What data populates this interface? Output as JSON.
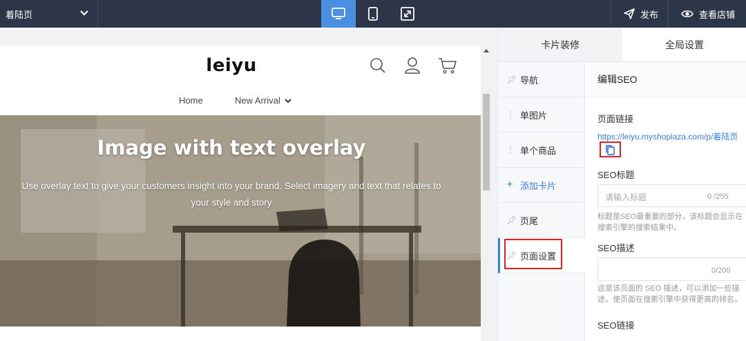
{
  "topbar": {
    "page_select": "着陆页",
    "publish_label": "发布",
    "view_store_label": "查看店铺"
  },
  "preview": {
    "store_logo": "leiyu",
    "nav": [
      "Home",
      "New Arrival"
    ],
    "hero_title": "Image with text overlay",
    "hero_text": "Use overlay text to give your customers insight into your brand. Select imagery and text that relates to your style and story"
  },
  "panel": {
    "tabs": [
      "卡片装修",
      "全局设置"
    ],
    "sidebar": [
      {
        "label": "导航",
        "icon": "pin-icon"
      },
      {
        "label": "单图片",
        "icon": "drag-handle-icon"
      },
      {
        "label": "单个商品",
        "icon": "drag-handle-icon"
      },
      {
        "label": "添加卡片",
        "icon": "plus-icon"
      },
      {
        "label": "页尾",
        "icon": "pin-icon"
      },
      {
        "label": "页面设置",
        "icon": "pin-icon"
      }
    ],
    "seo": {
      "header": "编辑SEO",
      "page_link_label": "页面链接",
      "page_link_url": "https://leiyu.myshoplaza.com/p/着陆页",
      "title_label": "SEO标题",
      "title_placeholder": "请输入标题",
      "title_counter": "0 /255",
      "title_help": "标题是SEO最重要的部分，该标题会显示在搜索引擎的搜索结果中。",
      "desc_label": "SEO描述",
      "desc_counter": "0/200",
      "desc_help": "这是该页面的 SEO 描述，可以添加一些描述，使页面在搜索引擎中获得更高的排名。",
      "link_label": "SEO链接"
    }
  },
  "colors": {
    "topbar": "#2d3549",
    "accent": "#4a90e2",
    "link": "#3a7fe0",
    "highlight": "#e02020"
  }
}
